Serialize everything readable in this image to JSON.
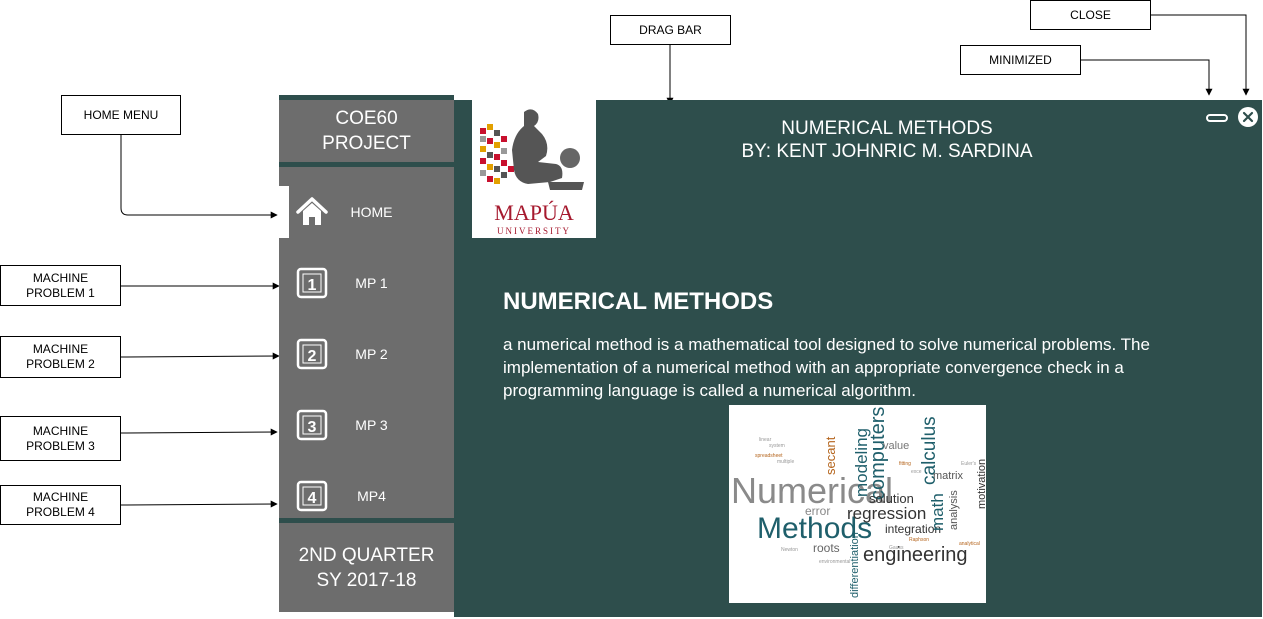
{
  "annotations": {
    "drag_bar": "DRAG BAR",
    "close": "CLOSE",
    "minimized": "MINIMIZED",
    "home_menu": "HOME MENU",
    "mp1": "MACHINE\nPROBLEM 1",
    "mp2": "MACHINE\nPROBLEM 2",
    "mp3": "MACHINE\nPROBLEM 3",
    "mp4": "MACHINE\nPROBLEM 4"
  },
  "sidebar": {
    "header": "COE60\nPROJECT",
    "items": [
      {
        "label": "HOME",
        "icon": "home-icon"
      },
      {
        "label": "MP 1",
        "icon": "number-1-icon"
      },
      {
        "label": "MP 2",
        "icon": "number-2-icon"
      },
      {
        "label": "MP 3",
        "icon": "number-3-icon"
      },
      {
        "label": "MP4",
        "icon": "number-4-icon"
      }
    ],
    "footer": "2ND QUARTER\nSY 2017-18"
  },
  "main": {
    "title_line1": "NUMERICAL METHODS",
    "title_line2": "BY: KENT JOHNRIC M. SARDINA",
    "logo_name": "MAPÚA",
    "logo_sub": "UNIVERSITY",
    "heading": "NUMERICAL METHODS",
    "body": "a numerical method is a mathematical tool designed to solve numerical problems. The implementation of a numerical method with an appropriate convergence check in a programming language is called a numerical algorithm."
  },
  "word_cloud": {
    "words": [
      "Numerical",
      "Methods",
      "modeling",
      "computers",
      "calculus",
      "regression",
      "integration",
      "engineering",
      "math",
      "analysis",
      "motivation",
      "differentiation",
      "roots",
      "error",
      "secant",
      "value",
      "solution",
      "matrix"
    ]
  },
  "colors": {
    "panel": "#2e4e4c",
    "sidebar": "#6d6d6d",
    "logo_red": "#a6192e"
  }
}
